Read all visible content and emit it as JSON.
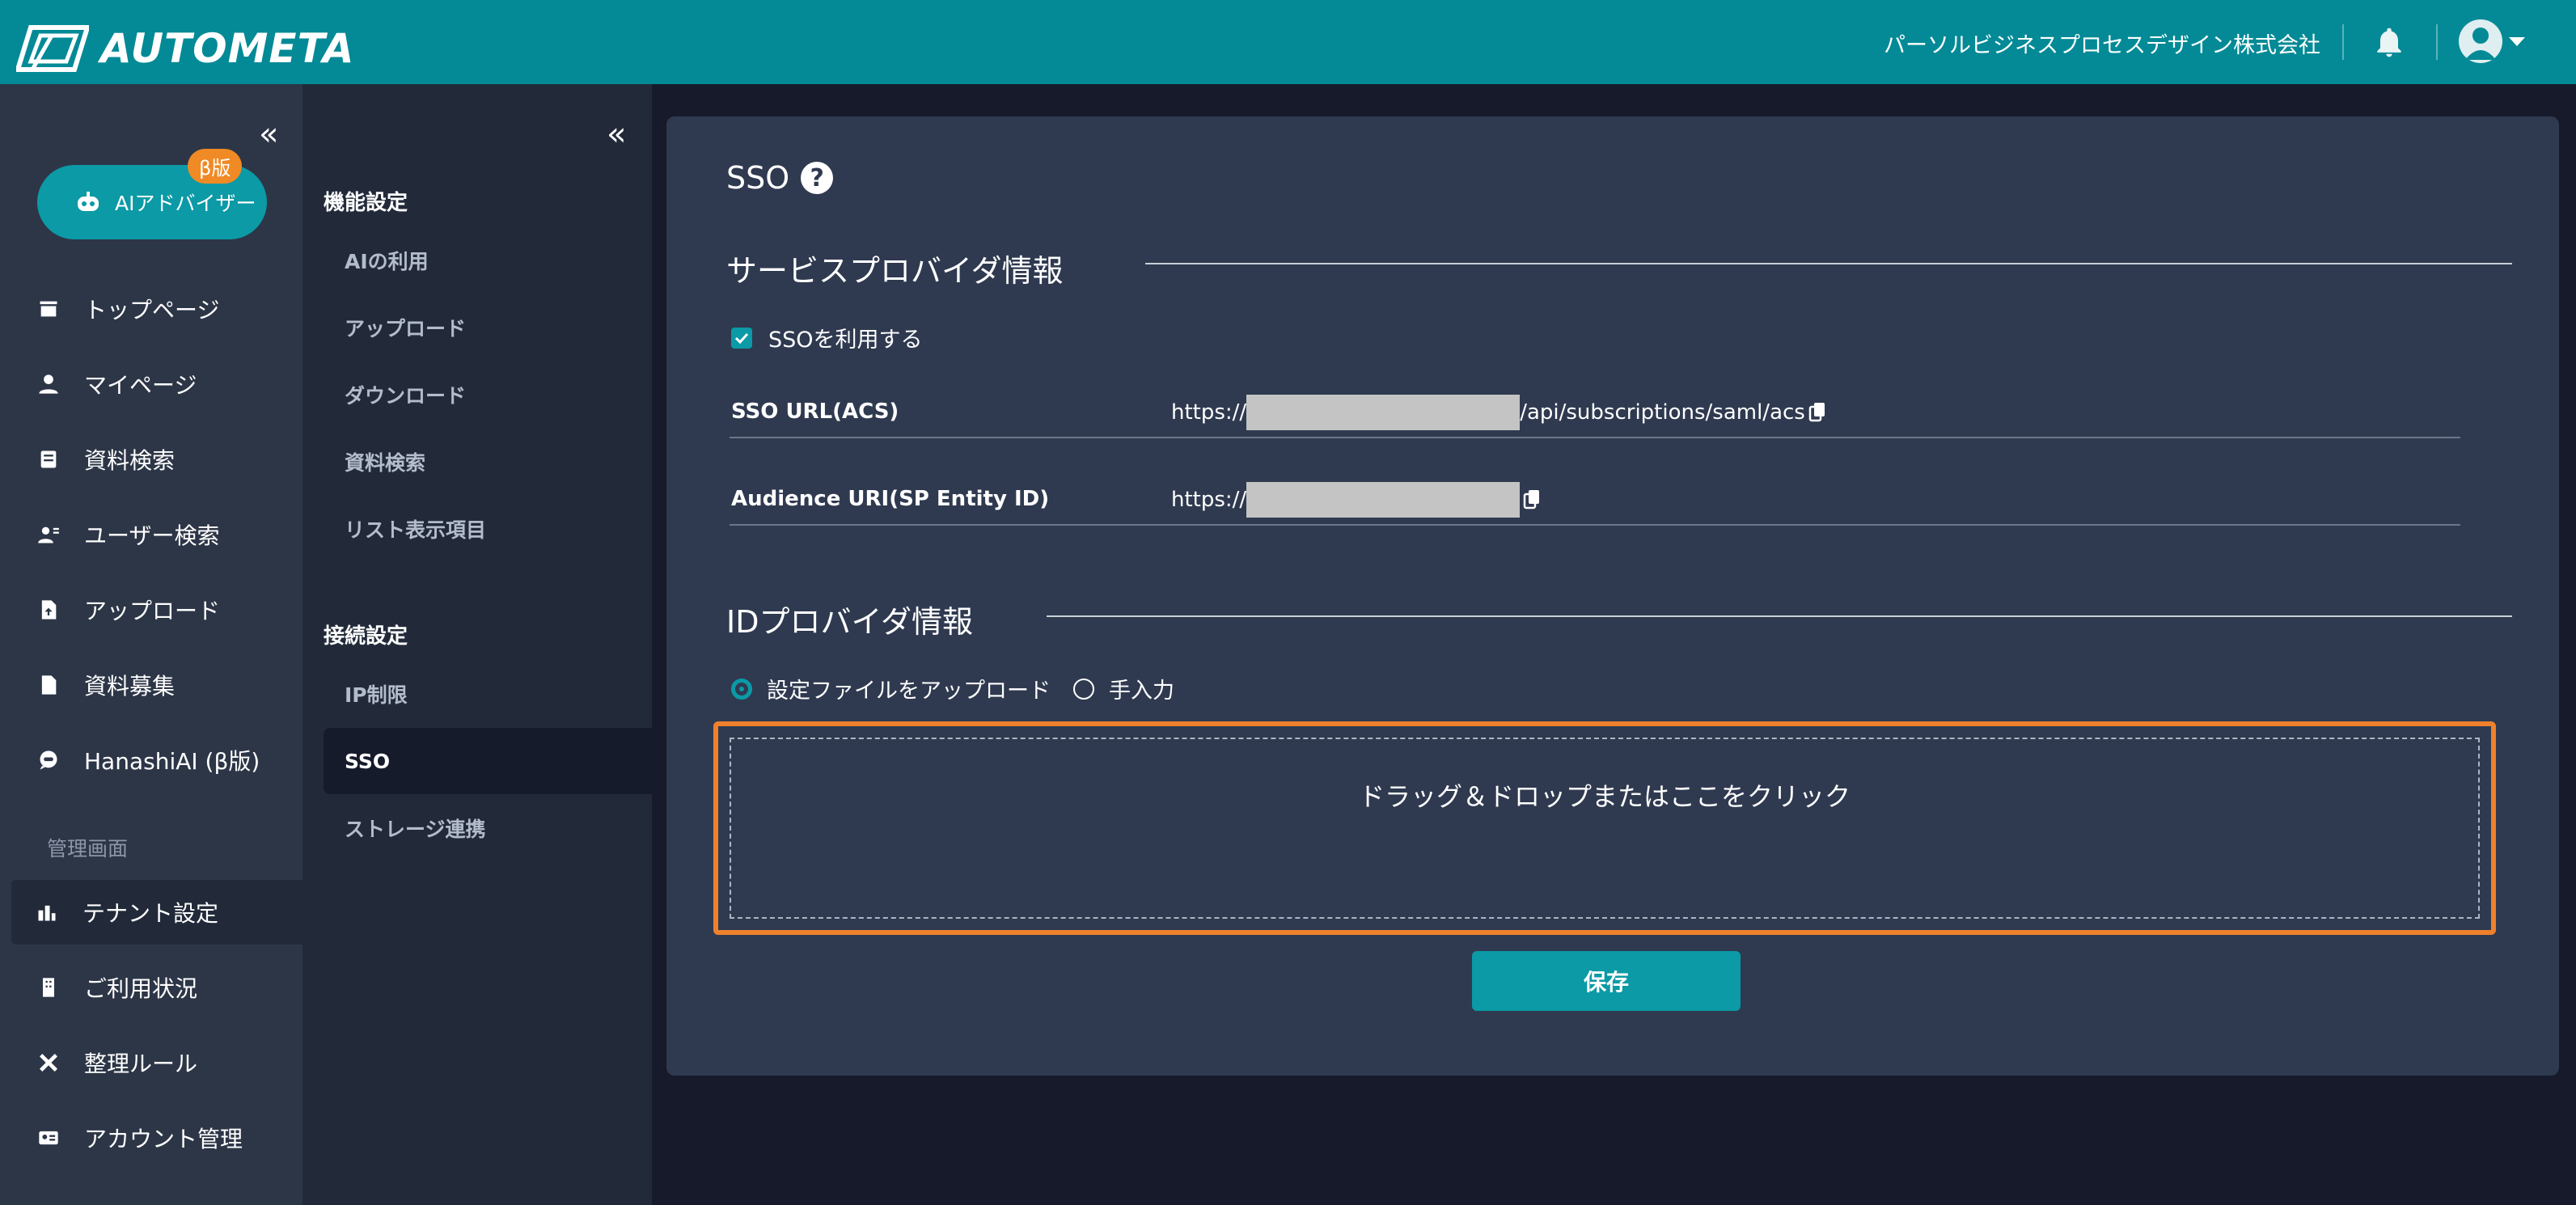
{
  "header": {
    "app_name": "AUTOMETA",
    "company": "パーソルビジネスプロセスデザイン株式会社",
    "icons": {
      "logo": "autometa-logo-icon",
      "bell": "bell-icon",
      "avatar": "user-avatar-icon",
      "menu": "chevron-down-icon"
    },
    "accent_color": "#038a96"
  },
  "sidebar": {
    "ai_button": {
      "label": "AIアドバイザー",
      "badge": "β版"
    },
    "items": [
      {
        "label": "トップページ",
        "icon": "store-icon"
      },
      {
        "label": "マイページ",
        "icon": "person-icon"
      },
      {
        "label": "資料検索",
        "icon": "document-search-icon"
      },
      {
        "label": "ユーザー検索",
        "icon": "user-search-icon"
      },
      {
        "label": "アップロード",
        "icon": "file-upload-icon"
      },
      {
        "label": "資料募集",
        "icon": "file-icon"
      },
      {
        "label": "HanashiAI (β版)",
        "icon": "chat-icon"
      }
    ],
    "admin_label": "管理画面",
    "admin_items": [
      {
        "label": "テナント設定",
        "icon": "tenant-icon",
        "active": true
      },
      {
        "label": "ご利用状況",
        "icon": "building-icon"
      },
      {
        "label": "整理ルール",
        "icon": "tools-icon"
      },
      {
        "label": "アカウント管理",
        "icon": "id-card-icon"
      }
    ]
  },
  "subsidebar": {
    "group1": {
      "heading": "機能設定",
      "items": [
        "AIの利用",
        "アップロード",
        "ダウンロード",
        "資料検索",
        "リスト表示項目"
      ]
    },
    "group2": {
      "heading": "接続設定",
      "items": [
        "IP制限",
        "SSO",
        "ストレージ連携"
      ]
    },
    "active_item": "SSO"
  },
  "main": {
    "title": "SSO",
    "sp_section": "サービスプロバイダ情報",
    "use_sso": {
      "label": "SSOを利用する",
      "checked": true
    },
    "fields": [
      {
        "label": "SSO URL(ACS)",
        "prefix": "https://",
        "suffix": "/api/subscriptions/saml/acs"
      },
      {
        "label": "Audience URI(SP Entity ID)",
        "prefix": "https://",
        "suffix": ""
      }
    ],
    "idp_section": "IDプロバイダ情報",
    "radios": [
      {
        "label": "設定ファイルをアップロード",
        "selected": true
      },
      {
        "label": "手入力",
        "selected": false
      }
    ],
    "dropzone": "ドラッグ＆ドロップまたはここをクリック",
    "save": "保存",
    "highlight_color": "#f0802b"
  }
}
